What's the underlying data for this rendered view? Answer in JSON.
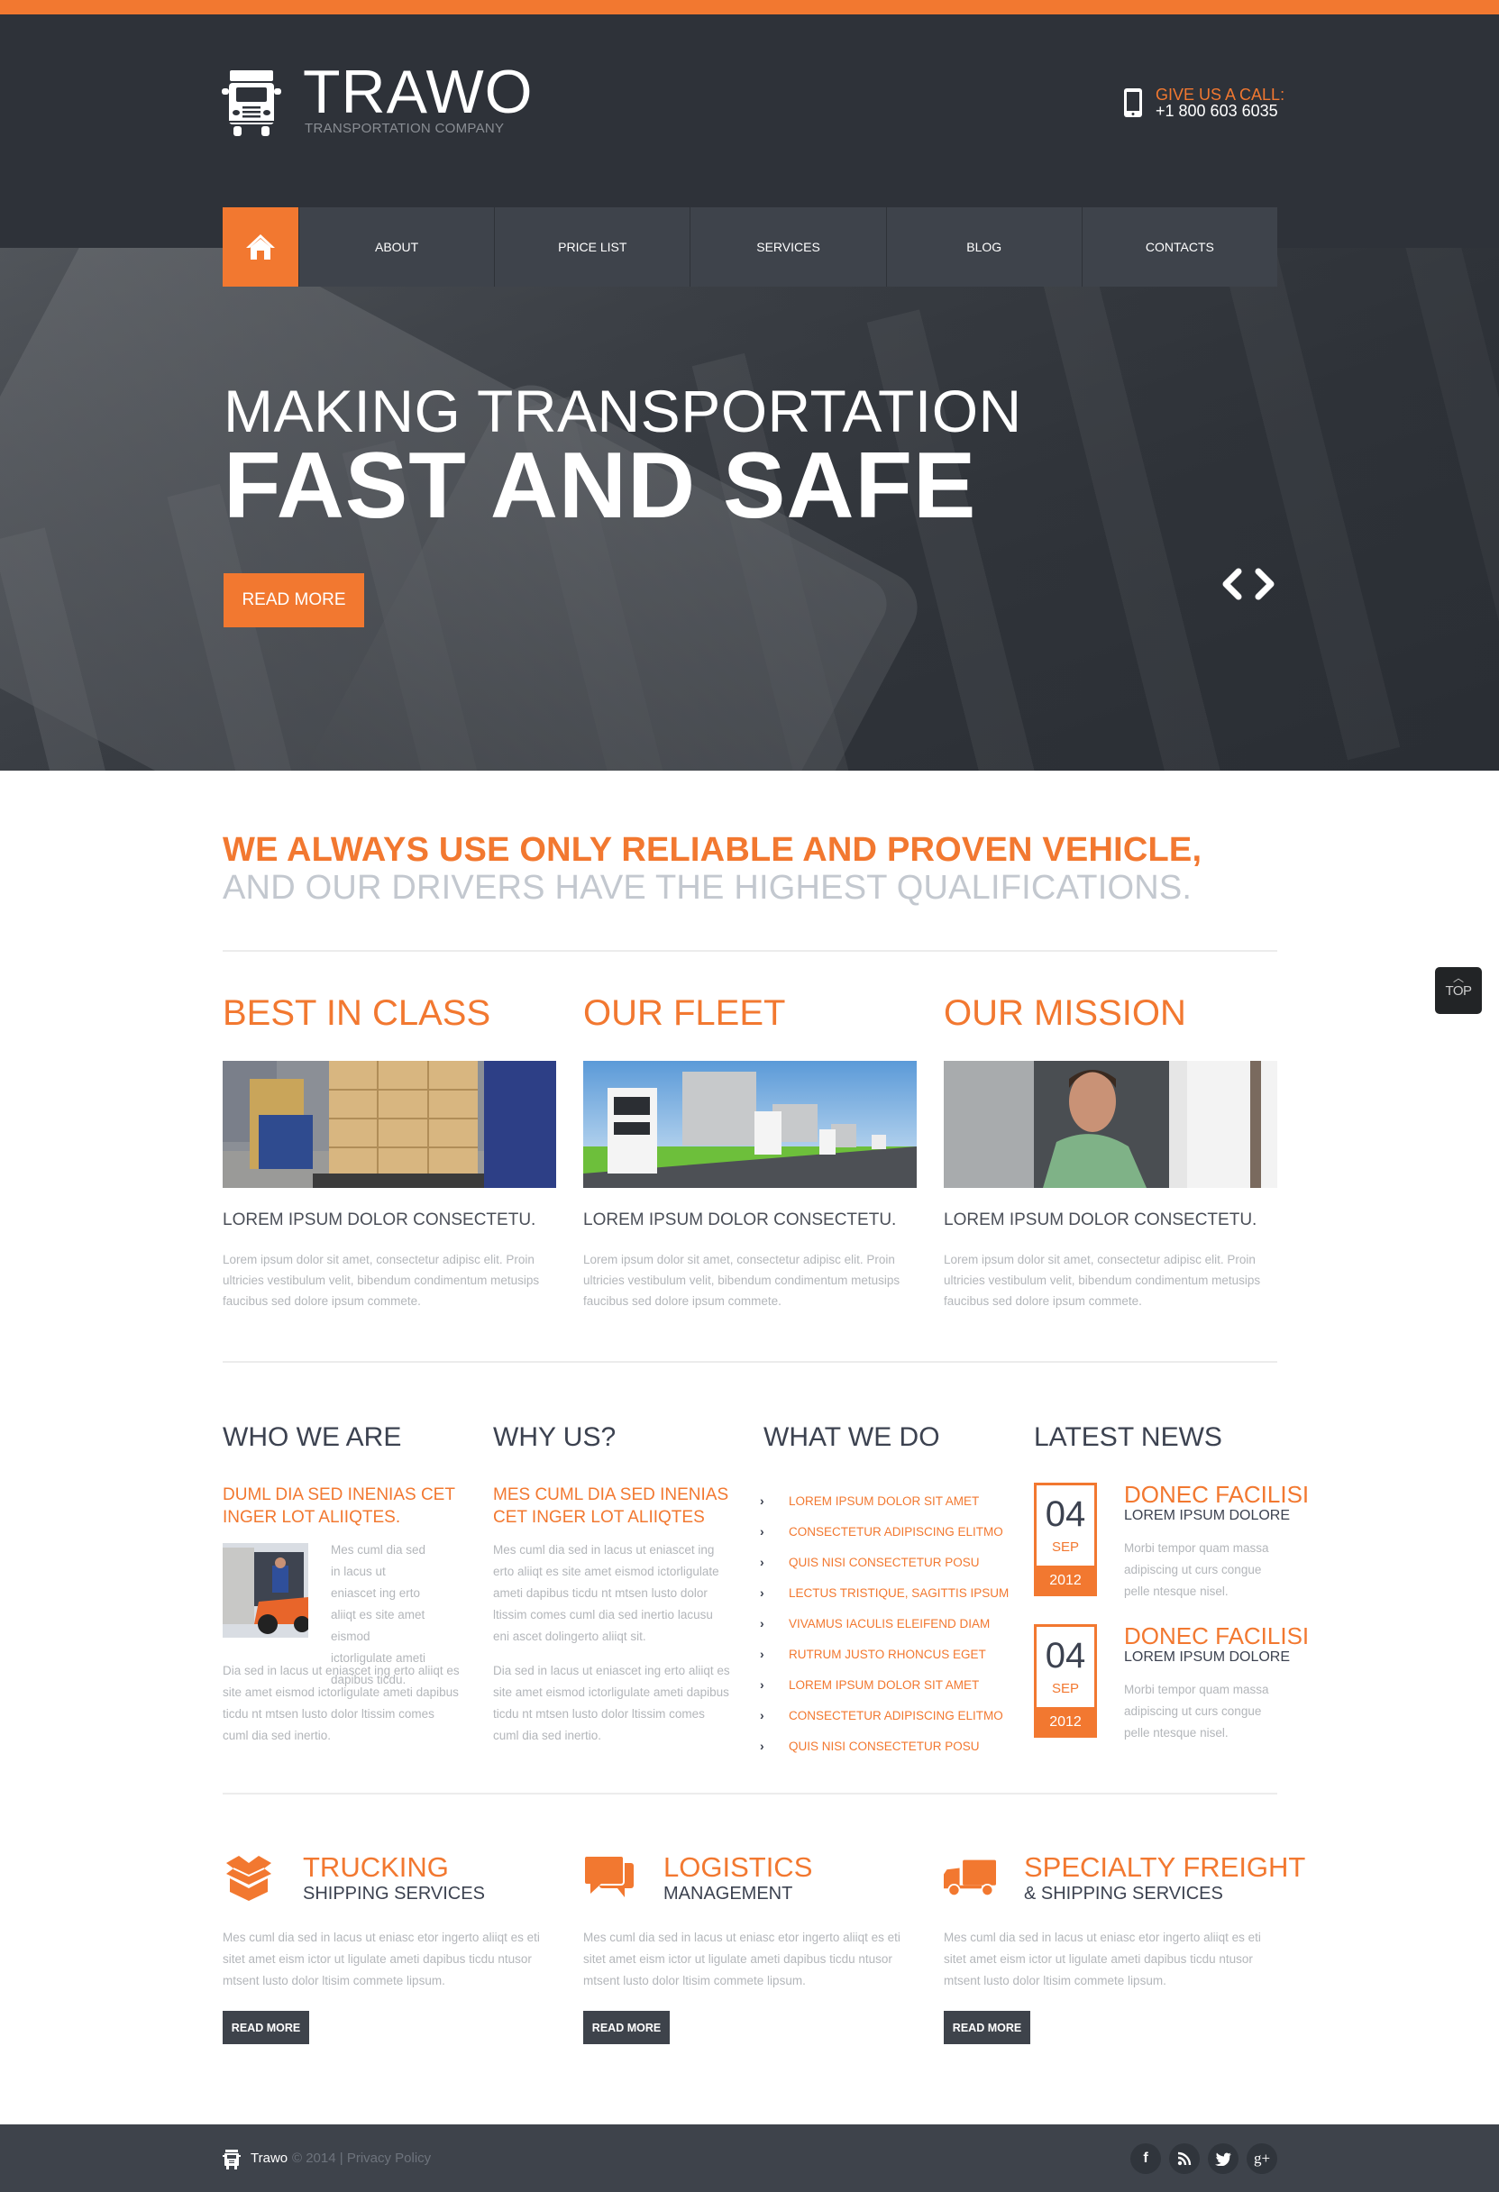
{
  "header": {
    "brand": "TRAWO",
    "brand_sub": "TRANSPORTATION COMPANY",
    "call_label": "GIVE US A CALL:",
    "call_number": "+1 800 603 6035"
  },
  "nav": {
    "home_icon": "home-icon",
    "items": [
      {
        "label": "ABOUT"
      },
      {
        "label": "PRICE LIST"
      },
      {
        "label": "SERVICES"
      },
      {
        "label": "BLOG"
      },
      {
        "label": "CONTACTS"
      }
    ]
  },
  "hero": {
    "line1": "MAKING TRANSPORTATION",
    "line2": "FAST AND SAFE",
    "button": "READ MORE",
    "prev_icon": "chevron-left-icon",
    "next_icon": "chevron-right-icon"
  },
  "tagline": {
    "line1": "WE ALWAYS USE ONLY RELIABLE AND PROVEN VEHICLE,",
    "line2": "AND OUR DRIVERS HAVE THE HIGHEST QUALIFICATIONS."
  },
  "features": [
    {
      "title": "BEST IN CLASS",
      "image": "forklift-boxes-photo",
      "subtitle": "LOREM IPSUM DOLOR CONSECTETU.",
      "text": "Lorem ipsum dolor sit amet, consectetur adipisc elit. Proin ultricies vestibulum velit, bibendum condimentum metusips faucibus sed dolore ipsum commete."
    },
    {
      "title": "OUR FLEET",
      "image": "trucks-convoy-photo",
      "subtitle": "LOREM IPSUM DOLOR CONSECTETU.",
      "text": "Lorem ipsum dolor sit amet, consectetur adipisc elit. Proin ultricies vestibulum velit, bibendum condimentum metusips faucibus sed dolore ipsum commete."
    },
    {
      "title": "OUR MISSION",
      "image": "smiling-driver-photo",
      "subtitle": "LOREM IPSUM DOLOR CONSECTETU.",
      "text": "Lorem ipsum dolor sit amet, consectetur adipisc elit. Proin ultricies vestibulum velit, bibendum condimentum metusips faucibus sed dolore ipsum commete."
    }
  ],
  "who": {
    "title": "WHO WE ARE",
    "subtitle": "DUML DIA SED INENIAS CET INGER LOT ALIIQTES.",
    "text1": "Mes cuml dia sed in lacus ut eniascet ing erto aliiqt es site amet eismod ictorligulate ameti dapibus ticdu.",
    "text2": "Dia sed in lacus ut eniascet ing erto aliiqt es site amet eismod ictorligulate ameti dapibus ticdu nt mtsen lusto dolor ltissim comes cuml dia sed inertio."
  },
  "why": {
    "title": "WHY US?",
    "subtitle": "MES CUML DIA SED INENIAS CET INGER LOT ALIIQTES",
    "text1": "Mes cuml dia sed in lacus ut eniascet ing erto aliiqt es site amet eismod ictorligulate ameti dapibus ticdu nt mtsen lusto dolor ltissim comes cuml dia sed inertio lacusu eni ascet dolingerto aliiqt sit.",
    "text2": "Dia sed in lacus ut eniascet ing erto aliiqt es site amet eismod ictorligulate ameti dapibus ticdu nt mtsen lusto dolor ltissim comes cuml dia sed inertio."
  },
  "what": {
    "title": "WHAT WE DO",
    "items": [
      "LOREM IPSUM DOLOR SIT AMET",
      "CONSECTETUR ADIPISCING ELITMO",
      "QUIS NISI CONSECTETUR POSU",
      "LECTUS TRISTIQUE, SAGITTIS IPSUM",
      "VIVAMUS IACULIS ELEIFEND DIAM",
      "RUTRUM JUSTO RHONCUS EGET",
      "LOREM IPSUM DOLOR SIT AMET",
      "CONSECTETUR ADIPISCING ELITMO",
      "QUIS NISI CONSECTETUR POSU"
    ]
  },
  "news": {
    "title": "LATEST NEWS",
    "items": [
      {
        "day": "04",
        "month": "SEP",
        "year": "2012",
        "title": "DONEC FACILISI",
        "subtitle": "LOREM IPSUM DOLORE",
        "text": "Morbi tempor quam massa adipiscing ut curs congue pelle ntesque nisel."
      },
      {
        "day": "04",
        "month": "SEP",
        "year": "2012",
        "title": "DONEC FACILISI",
        "subtitle": "LOREM IPSUM DOLORE",
        "text": "Morbi tempor quam massa adipiscing ut curs congue pelle ntesque nisel."
      }
    ]
  },
  "services": [
    {
      "icon": "open-box-icon",
      "title": "TRUCKING",
      "subtitle": "SHIPPING SERVICES",
      "text": "Mes cuml dia sed in lacus ut eniasc etor ingerto aliiqt es eti sitet amet eism ictor ut ligulate ameti dapibus ticdu ntusor mtsent lusto dolor ltisim commete lipsum.",
      "button": "READ MORE"
    },
    {
      "icon": "chat-bubbles-icon",
      "title": "LOGISTICS",
      "subtitle": "MANAGEMENT",
      "text": "Mes cuml dia sed in lacus ut eniasc etor ingerto aliiqt es eti sitet amet eism ictor ut ligulate ameti dapibus ticdu ntusor mtsent lusto dolor ltisim commete lipsum.",
      "button": "READ MORE"
    },
    {
      "icon": "truck-icon",
      "title": "SPECIALTY FREIGHT",
      "subtitle": "& SHIPPING SERVICES",
      "text": "Mes cuml dia sed in lacus ut eniasc etor ingerto aliiqt es eti sitet amet eism ictor ut ligulate ameti dapibus ticdu ntusor mtsent lusto dolor ltisim commete lipsum.",
      "button": "READ MORE"
    }
  ],
  "footer": {
    "brand": "Trawo",
    "copyright": "© 2014 | Privacy Policy",
    "social": [
      {
        "name": "facebook",
        "glyph": "f"
      },
      {
        "name": "rss",
        "glyph": "⌇"
      },
      {
        "name": "twitter",
        "glyph": "t"
      },
      {
        "name": "google-plus",
        "glyph": "g+"
      }
    ]
  },
  "scroll_top": {
    "label": "TOP"
  },
  "colors": {
    "accent": "#f27830",
    "dark": "#2e3239",
    "nav": "#3e434b",
    "text_gray": "#b3b6ba"
  }
}
